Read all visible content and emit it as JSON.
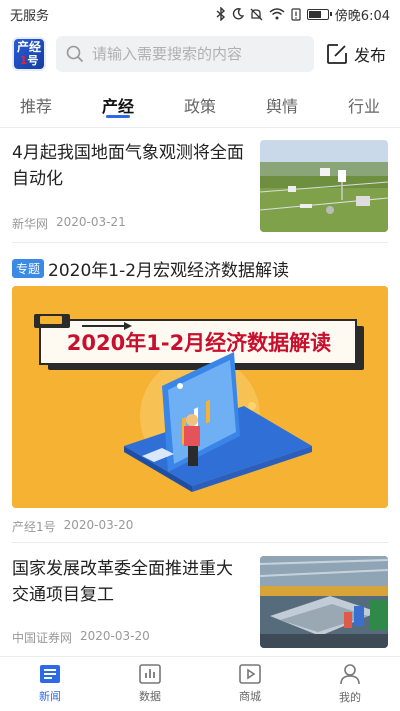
{
  "status_bar": {
    "carrier": "无服务",
    "time": "傍晚6:04"
  },
  "header": {
    "logo_line1": "产经",
    "logo_line2_prefix": "1",
    "logo_line2_suffix": "号",
    "search_placeholder": "请输入需要搜索的内容",
    "publish_label": "发布"
  },
  "tabs": [
    {
      "label": "推荐",
      "active": false
    },
    {
      "label": "产经",
      "active": true
    },
    {
      "label": "政策",
      "active": false
    },
    {
      "label": "舆情",
      "active": false
    },
    {
      "label": "行业",
      "active": false
    }
  ],
  "feed": [
    {
      "title": "4月起我国地面气象观测将全面自动化",
      "source": "新华网",
      "date": "2020-03-21"
    },
    {
      "tag": "专题",
      "title": "2020年1-2月宏观经济数据解读",
      "banner_text": "2020年1-2月经济数据解读",
      "source": "产经1号",
      "date": "2020-03-20"
    },
    {
      "title": "国家发展改革委全面推进重大交通项目复工",
      "source": "中国证券网",
      "date": "2020-03-20"
    }
  ],
  "bottom_nav": [
    {
      "label": "新闻",
      "icon": "news-icon",
      "active": true
    },
    {
      "label": "数据",
      "icon": "chart-icon",
      "active": false
    },
    {
      "label": "商城",
      "icon": "play-icon",
      "active": false
    },
    {
      "label": "我的",
      "icon": "user-icon",
      "active": false
    }
  ],
  "colors": {
    "accent": "#2d6be4",
    "tag": "#3b8ae6",
    "banner_bg": "#f5b233",
    "banner_title": "#c8102e"
  }
}
